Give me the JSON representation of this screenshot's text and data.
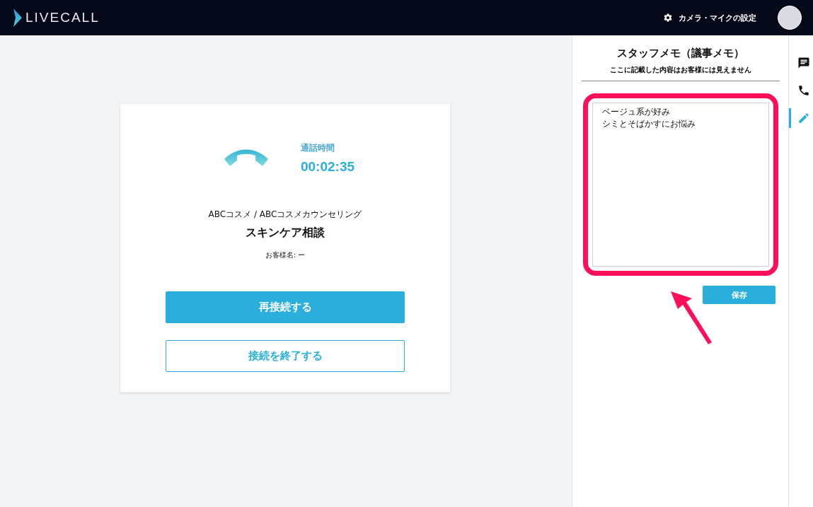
{
  "header": {
    "logo": "LIVECALL",
    "settings_label": "カメラ・マイクの設定"
  },
  "call": {
    "duration_label": "通話時間",
    "duration": "00:02:35",
    "shop": "ABCコスメ / ABCコスメカウンセリング",
    "title": "スキンケア相談",
    "customer": "お客様名: ー",
    "reconnect_button": "再接続する",
    "end_button": "接続を終了する"
  },
  "memo": {
    "title": "スタッフメモ（議事メモ）",
    "note": "ここに記載した内容はお客様には見えません",
    "lines": [
      "ベージュ系が好み",
      "シミとそばかすにお悩み"
    ],
    "save_button": "保存",
    "highlighted": true
  },
  "rail": [
    {
      "kind": "chat",
      "selected": false
    },
    {
      "kind": "phone",
      "selected": false
    },
    {
      "kind": "memo",
      "selected": true
    }
  ]
}
